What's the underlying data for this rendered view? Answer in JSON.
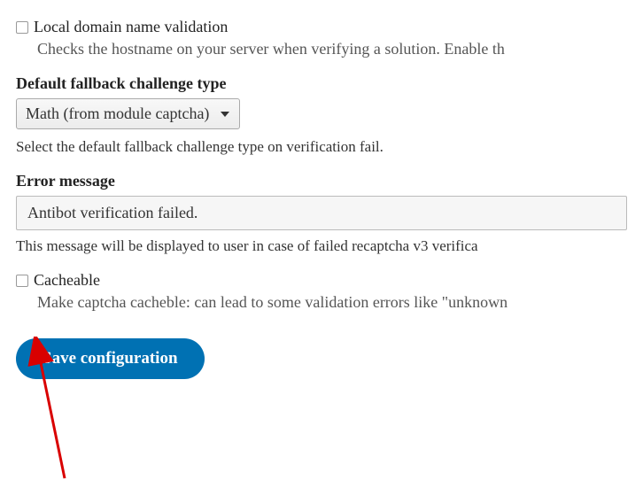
{
  "local_domain": {
    "label": "Local domain name validation",
    "description": "Checks the hostname on your server when verifying a solution. Enable th",
    "checked": false
  },
  "fallback": {
    "label": "Default fallback challenge type",
    "selected": "Math (from module captcha)",
    "help": "Select the default fallback challenge type on verification fail."
  },
  "error_message": {
    "label": "Error message",
    "value": "Antibot verification failed.",
    "help": "This message will be displayed to user in case of failed recaptcha v3 verifica"
  },
  "cacheable": {
    "label": "Cacheable",
    "description": "Make captcha cacheble: can lead to some validation errors like \"unknown",
    "checked": false
  },
  "save_button": "Save configuration"
}
